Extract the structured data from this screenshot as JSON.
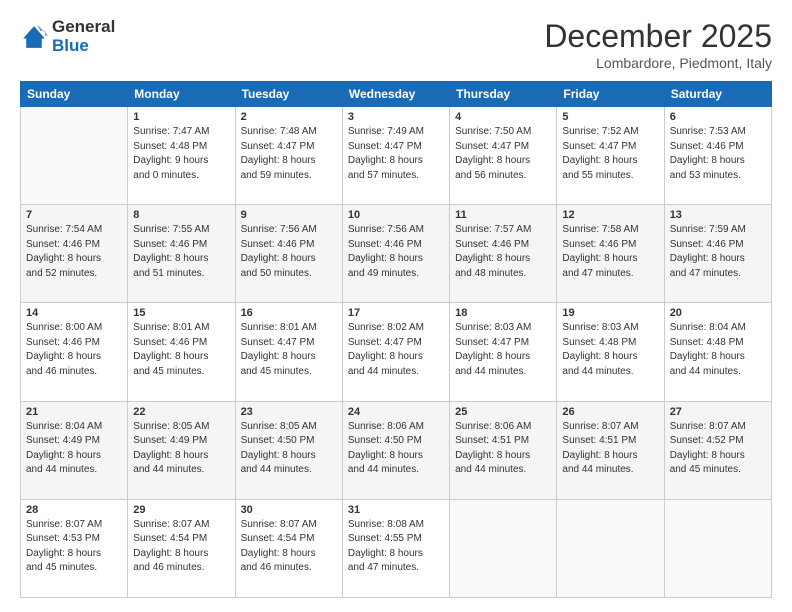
{
  "logo": {
    "general": "General",
    "blue": "Blue"
  },
  "header": {
    "month": "December 2025",
    "location": "Lombardore, Piedmont, Italy"
  },
  "weekdays": [
    "Sunday",
    "Monday",
    "Tuesday",
    "Wednesday",
    "Thursday",
    "Friday",
    "Saturday"
  ],
  "rows": [
    [
      {
        "day": "",
        "info": ""
      },
      {
        "day": "1",
        "info": "Sunrise: 7:47 AM\nSunset: 4:48 PM\nDaylight: 9 hours\nand 0 minutes."
      },
      {
        "day": "2",
        "info": "Sunrise: 7:48 AM\nSunset: 4:47 PM\nDaylight: 8 hours\nand 59 minutes."
      },
      {
        "day": "3",
        "info": "Sunrise: 7:49 AM\nSunset: 4:47 PM\nDaylight: 8 hours\nand 57 minutes."
      },
      {
        "day": "4",
        "info": "Sunrise: 7:50 AM\nSunset: 4:47 PM\nDaylight: 8 hours\nand 56 minutes."
      },
      {
        "day": "5",
        "info": "Sunrise: 7:52 AM\nSunset: 4:47 PM\nDaylight: 8 hours\nand 55 minutes."
      },
      {
        "day": "6",
        "info": "Sunrise: 7:53 AM\nSunset: 4:46 PM\nDaylight: 8 hours\nand 53 minutes."
      }
    ],
    [
      {
        "day": "7",
        "info": "Sunrise: 7:54 AM\nSunset: 4:46 PM\nDaylight: 8 hours\nand 52 minutes."
      },
      {
        "day": "8",
        "info": "Sunrise: 7:55 AM\nSunset: 4:46 PM\nDaylight: 8 hours\nand 51 minutes."
      },
      {
        "day": "9",
        "info": "Sunrise: 7:56 AM\nSunset: 4:46 PM\nDaylight: 8 hours\nand 50 minutes."
      },
      {
        "day": "10",
        "info": "Sunrise: 7:56 AM\nSunset: 4:46 PM\nDaylight: 8 hours\nand 49 minutes."
      },
      {
        "day": "11",
        "info": "Sunrise: 7:57 AM\nSunset: 4:46 PM\nDaylight: 8 hours\nand 48 minutes."
      },
      {
        "day": "12",
        "info": "Sunrise: 7:58 AM\nSunset: 4:46 PM\nDaylight: 8 hours\nand 47 minutes."
      },
      {
        "day": "13",
        "info": "Sunrise: 7:59 AM\nSunset: 4:46 PM\nDaylight: 8 hours\nand 47 minutes."
      }
    ],
    [
      {
        "day": "14",
        "info": "Sunrise: 8:00 AM\nSunset: 4:46 PM\nDaylight: 8 hours\nand 46 minutes."
      },
      {
        "day": "15",
        "info": "Sunrise: 8:01 AM\nSunset: 4:46 PM\nDaylight: 8 hours\nand 45 minutes."
      },
      {
        "day": "16",
        "info": "Sunrise: 8:01 AM\nSunset: 4:47 PM\nDaylight: 8 hours\nand 45 minutes."
      },
      {
        "day": "17",
        "info": "Sunrise: 8:02 AM\nSunset: 4:47 PM\nDaylight: 8 hours\nand 44 minutes."
      },
      {
        "day": "18",
        "info": "Sunrise: 8:03 AM\nSunset: 4:47 PM\nDaylight: 8 hours\nand 44 minutes."
      },
      {
        "day": "19",
        "info": "Sunrise: 8:03 AM\nSunset: 4:48 PM\nDaylight: 8 hours\nand 44 minutes."
      },
      {
        "day": "20",
        "info": "Sunrise: 8:04 AM\nSunset: 4:48 PM\nDaylight: 8 hours\nand 44 minutes."
      }
    ],
    [
      {
        "day": "21",
        "info": "Sunrise: 8:04 AM\nSunset: 4:49 PM\nDaylight: 8 hours\nand 44 minutes."
      },
      {
        "day": "22",
        "info": "Sunrise: 8:05 AM\nSunset: 4:49 PM\nDaylight: 8 hours\nand 44 minutes."
      },
      {
        "day": "23",
        "info": "Sunrise: 8:05 AM\nSunset: 4:50 PM\nDaylight: 8 hours\nand 44 minutes."
      },
      {
        "day": "24",
        "info": "Sunrise: 8:06 AM\nSunset: 4:50 PM\nDaylight: 8 hours\nand 44 minutes."
      },
      {
        "day": "25",
        "info": "Sunrise: 8:06 AM\nSunset: 4:51 PM\nDaylight: 8 hours\nand 44 minutes."
      },
      {
        "day": "26",
        "info": "Sunrise: 8:07 AM\nSunset: 4:51 PM\nDaylight: 8 hours\nand 44 minutes."
      },
      {
        "day": "27",
        "info": "Sunrise: 8:07 AM\nSunset: 4:52 PM\nDaylight: 8 hours\nand 45 minutes."
      }
    ],
    [
      {
        "day": "28",
        "info": "Sunrise: 8:07 AM\nSunset: 4:53 PM\nDaylight: 8 hours\nand 45 minutes."
      },
      {
        "day": "29",
        "info": "Sunrise: 8:07 AM\nSunset: 4:54 PM\nDaylight: 8 hours\nand 46 minutes."
      },
      {
        "day": "30",
        "info": "Sunrise: 8:07 AM\nSunset: 4:54 PM\nDaylight: 8 hours\nand 46 minutes."
      },
      {
        "day": "31",
        "info": "Sunrise: 8:08 AM\nSunset: 4:55 PM\nDaylight: 8 hours\nand 47 minutes."
      },
      {
        "day": "",
        "info": ""
      },
      {
        "day": "",
        "info": ""
      },
      {
        "day": "",
        "info": ""
      }
    ]
  ]
}
